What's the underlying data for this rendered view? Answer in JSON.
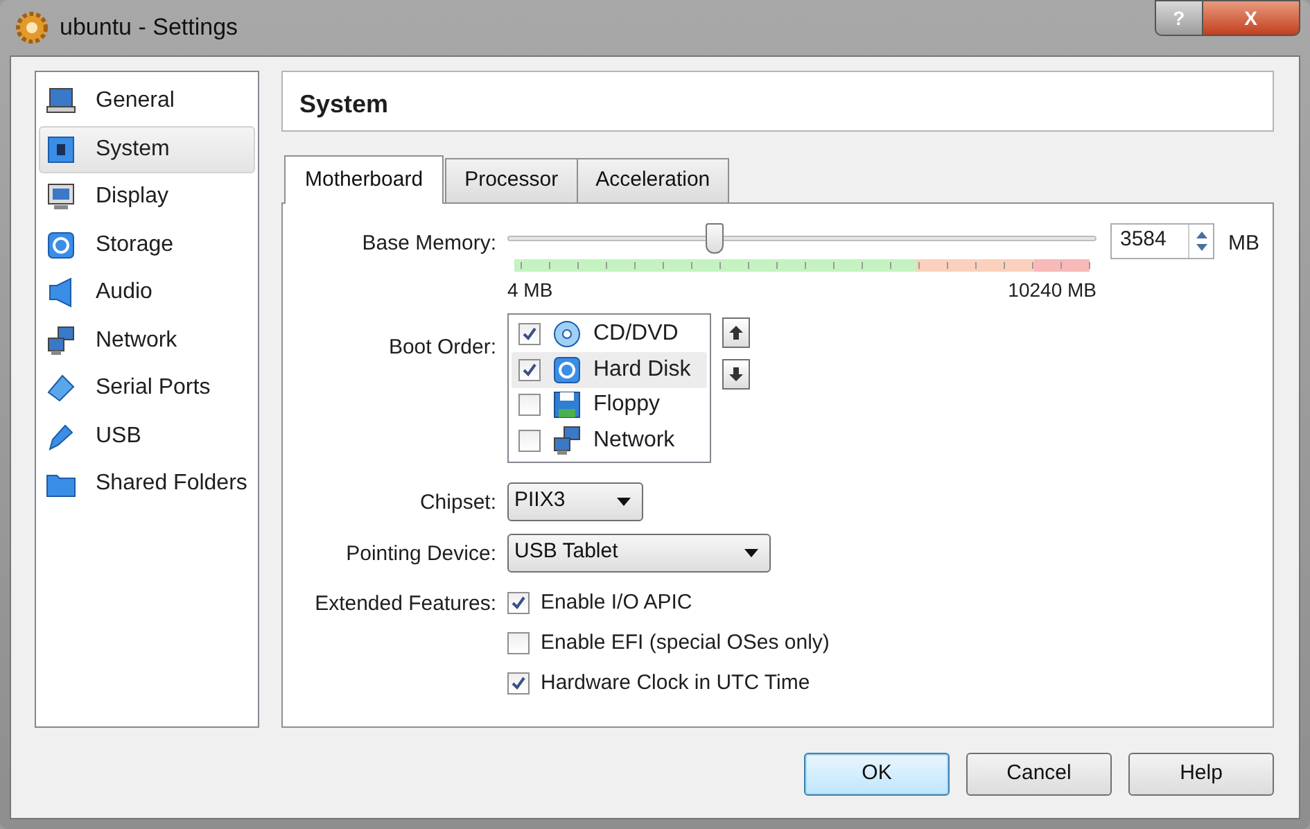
{
  "window": {
    "title": "ubuntu - Settings",
    "help_button": "?",
    "close_button": "X"
  },
  "sidebar": {
    "items": [
      {
        "label": "General",
        "kind": "general",
        "selected": false
      },
      {
        "label": "System",
        "kind": "system",
        "selected": true
      },
      {
        "label": "Display",
        "kind": "display",
        "selected": false
      },
      {
        "label": "Storage",
        "kind": "storage",
        "selected": false
      },
      {
        "label": "Audio",
        "kind": "audio",
        "selected": false
      },
      {
        "label": "Network",
        "kind": "network",
        "selected": false
      },
      {
        "label": "Serial Ports",
        "kind": "serial",
        "selected": false
      },
      {
        "label": "USB",
        "kind": "usb",
        "selected": false
      },
      {
        "label": "Shared Folders",
        "kind": "folder",
        "selected": false
      }
    ]
  },
  "page_title": "System",
  "tabs": [
    {
      "label": "Motherboard",
      "selected": true
    },
    {
      "label": "Processor",
      "selected": false
    },
    {
      "label": "Acceleration",
      "selected": false
    }
  ],
  "base_memory": {
    "label": "Base Memory:",
    "level": 0.35,
    "value": "3584",
    "unit": "MB",
    "min_label": "4 MB",
    "max_label": "10240 MB"
  },
  "boot_order": {
    "label": "Boot Order:",
    "items": [
      {
        "label": "CD/DVD",
        "kind": "optical",
        "checked": true,
        "selected": false
      },
      {
        "label": "Hard Disk",
        "kind": "harddisk",
        "checked": true,
        "selected": true
      },
      {
        "label": "Floppy",
        "kind": "floppy",
        "checked": false,
        "selected": false
      },
      {
        "label": "Network",
        "kind": "network",
        "checked": false,
        "selected": false
      }
    ]
  },
  "chipset": {
    "label": "Chipset:",
    "value": "PIIX3"
  },
  "pointing_device": {
    "label": "Pointing Device:",
    "value": "USB Tablet"
  },
  "extended_features": {
    "label": "Extended Features:",
    "options": [
      {
        "label": "Enable I/O APIC",
        "checked": true
      },
      {
        "label": "Enable EFI (special OSes only)",
        "checked": false
      },
      {
        "label": "Hardware Clock in UTC Time",
        "checked": true
      }
    ]
  },
  "buttons": [
    {
      "label": "OK",
      "kind": "default"
    },
    {
      "label": "Cancel",
      "kind": "normal"
    },
    {
      "label": "Help",
      "kind": "normal"
    }
  ]
}
